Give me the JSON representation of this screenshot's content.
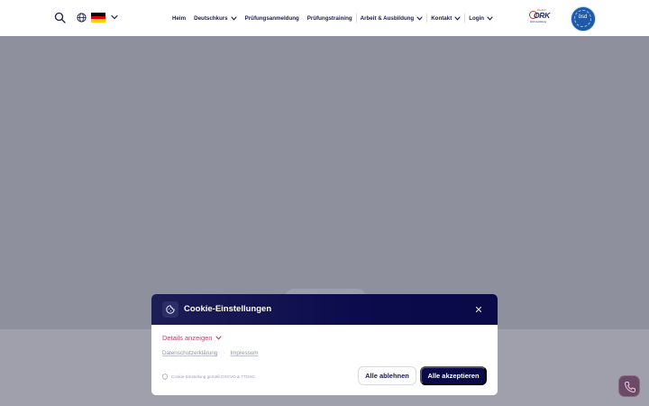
{
  "header": {
    "nav": [
      {
        "label": "Heim",
        "dropdown": false
      },
      {
        "label": "Deutschkurs",
        "dropdown": true
      },
      {
        "label": "Prüfungsanmeldung",
        "dropdown": false
      },
      {
        "label": "Prüfungstraining",
        "dropdown": false
      },
      {
        "label": "Arbeit & Ausbildung",
        "dropdown": true
      },
      {
        "label": "Kontakt",
        "dropdown": true
      },
      {
        "label": "Login",
        "dropdown": true
      }
    ],
    "language_flag": "de",
    "logos": {
      "work_main": "ORK",
      "work_top": "Deutsch",
      "work_sub": "Work Ausbildung",
      "osd": "ösd"
    }
  },
  "cookie": {
    "title": "Cookie-Einstellungen",
    "details_label": "Details anzeigen",
    "privacy_link": "Datenschutzerklärung",
    "imprint_link": "Impressum",
    "compliance_note": "Cookie-Einstellung gemäß DSGVO & TTDSG",
    "decline_label": "Alle ablehnen",
    "accept_label": "Alle akzeptieren"
  },
  "colors": {
    "navy": "#0a0a48",
    "accent_link": "#b1476b",
    "overlay": "#8f909e"
  },
  "icons": {
    "search": "search-icon",
    "globe": "globe-icon",
    "chevron": "chevron-down-icon",
    "cookie": "cookie-icon",
    "close": "close-icon",
    "shield": "shield-icon",
    "phone": "phone-icon"
  }
}
